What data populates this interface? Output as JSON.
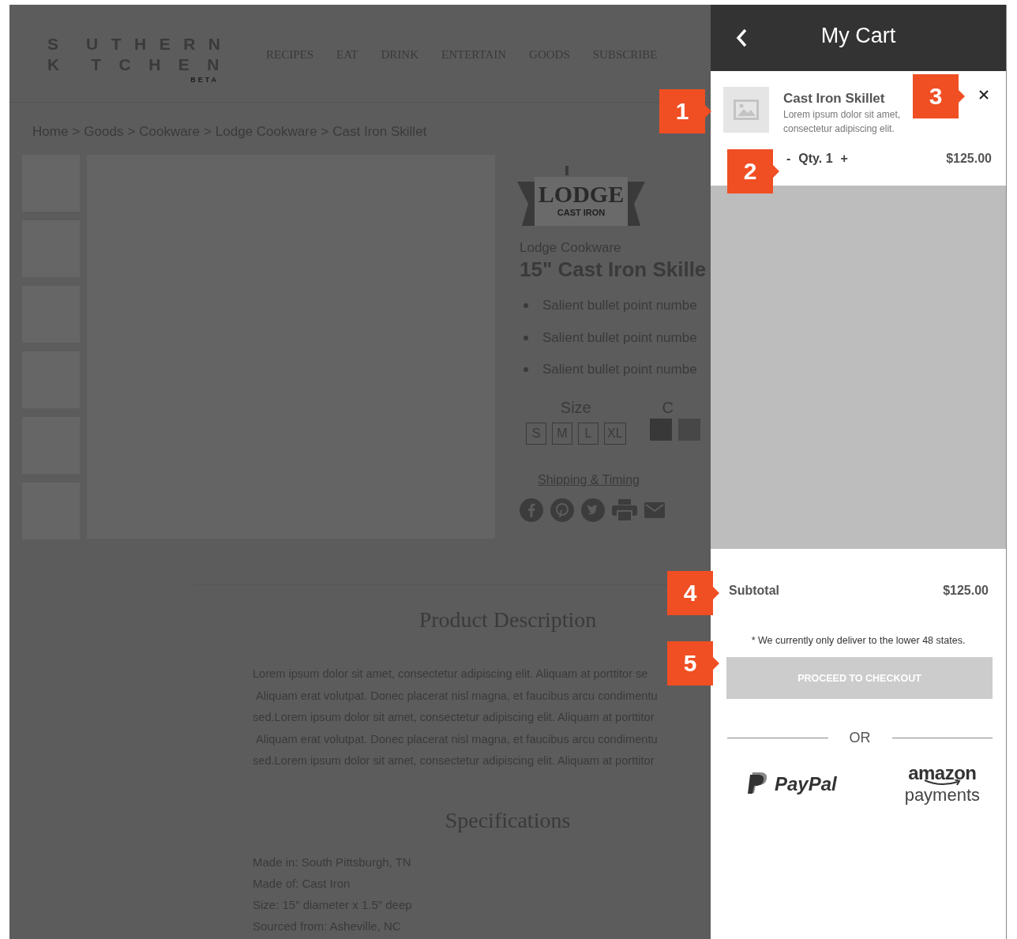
{
  "site": {
    "logo": {
      "row1_start": "S",
      "row1_end": "UTHERN",
      "row2_start": "K",
      "row2_end": "TCHEN",
      "badge": "BETA"
    },
    "nav": [
      {
        "label": "RECIPES"
      },
      {
        "label": "EAT"
      },
      {
        "label": "DRINK"
      },
      {
        "label": "ENTERTAIN"
      },
      {
        "label": "GOODS"
      },
      {
        "label": "SUBSCRIBE"
      }
    ],
    "breadcrumb": {
      "separator": ">",
      "items": [
        "Home",
        "Goods",
        "Cookware",
        "Lodge Cookware",
        "Cast Iron Skillet"
      ]
    },
    "thumbnails": [
      {
        "kind": "placeholder"
      },
      {
        "kind": "placeholder"
      },
      {
        "kind": "placeholder"
      },
      {
        "kind": "placeholder"
      },
      {
        "kind": "placeholder"
      },
      {
        "kind": "placeholder"
      }
    ],
    "main_image": {
      "kind": "placeholder"
    },
    "product": {
      "brand_logo": {
        "name": "LODGE",
        "subtitle": "CAST IRON"
      },
      "brand": "Lodge Cookware",
      "title": "15\" Cast Iron Skille",
      "bullets": [
        "Salient bullet point numbe",
        "Salient bullet point numbe",
        "Salient bullet point numbe"
      ],
      "size_label": "Size",
      "sizes": [
        "S",
        "M",
        "L",
        "XL"
      ],
      "color_label": "C",
      "swatches": [
        {
          "color": "#383838"
        },
        {
          "color": "#474747"
        }
      ],
      "shipping_link": "Shipping & Timing",
      "share": [
        {
          "kind": "facebook"
        },
        {
          "kind": "pinterest"
        },
        {
          "kind": "twitter"
        },
        {
          "kind": "print"
        },
        {
          "kind": "mail"
        }
      ]
    },
    "description": {
      "heading": "Product Description",
      "lines": [
        "Lorem ipsum dolor sit amet, consectetur adipiscing elit. Aliquam at porttitor se",
        "Aliquam erat volutpat. Donec placerat nisl magna, et faucibus arcu condimentu",
        "sed.Lorem ipsum dolor sit amet, consectetur adipiscing elit. Aliquam at porttitor",
        "Aliquam erat volutpat. Donec placerat nisl magna, et faucibus arcu condimentu",
        "sed.Lorem ipsum dolor sit amet, consectetur adipiscing elit. Aliquam at porttitor"
      ]
    },
    "specifications": {
      "heading": "Specifications",
      "lines": [
        "Made in: South Pittsburgh, TN",
        "Made of: Cast Iron",
        "Size: 15\" diameter x 1.5\" deep",
        "Sourced from: Asheville, NC"
      ]
    }
  },
  "cart": {
    "title": "My Cart",
    "items": [
      {
        "name": "Cast Iron Skillet",
        "description": "Lorem ipsum dolor sit amet, consectetur adipiscing elit.",
        "decrement": "-",
        "quantity": "Qty. 1",
        "increment": "+",
        "price": "$125.00"
      }
    ],
    "subtotal_label": "Subtotal",
    "subtotal": "$125.00",
    "note": "* We currently only deliver to the lower 48 states.",
    "checkout_button": {
      "label": "PROCEED TO CHECKOUT",
      "disabled": true
    },
    "divider_text": "OR",
    "payment_options": [
      {
        "kind": "paypal",
        "label": "PayPal"
      },
      {
        "kind": "amazon",
        "label": "amazon",
        "sublabel": "payments"
      }
    ]
  },
  "callouts": [
    {
      "number": "1"
    },
    {
      "number": "2"
    },
    {
      "number": "3"
    },
    {
      "number": "4"
    },
    {
      "number": "5"
    }
  ]
}
